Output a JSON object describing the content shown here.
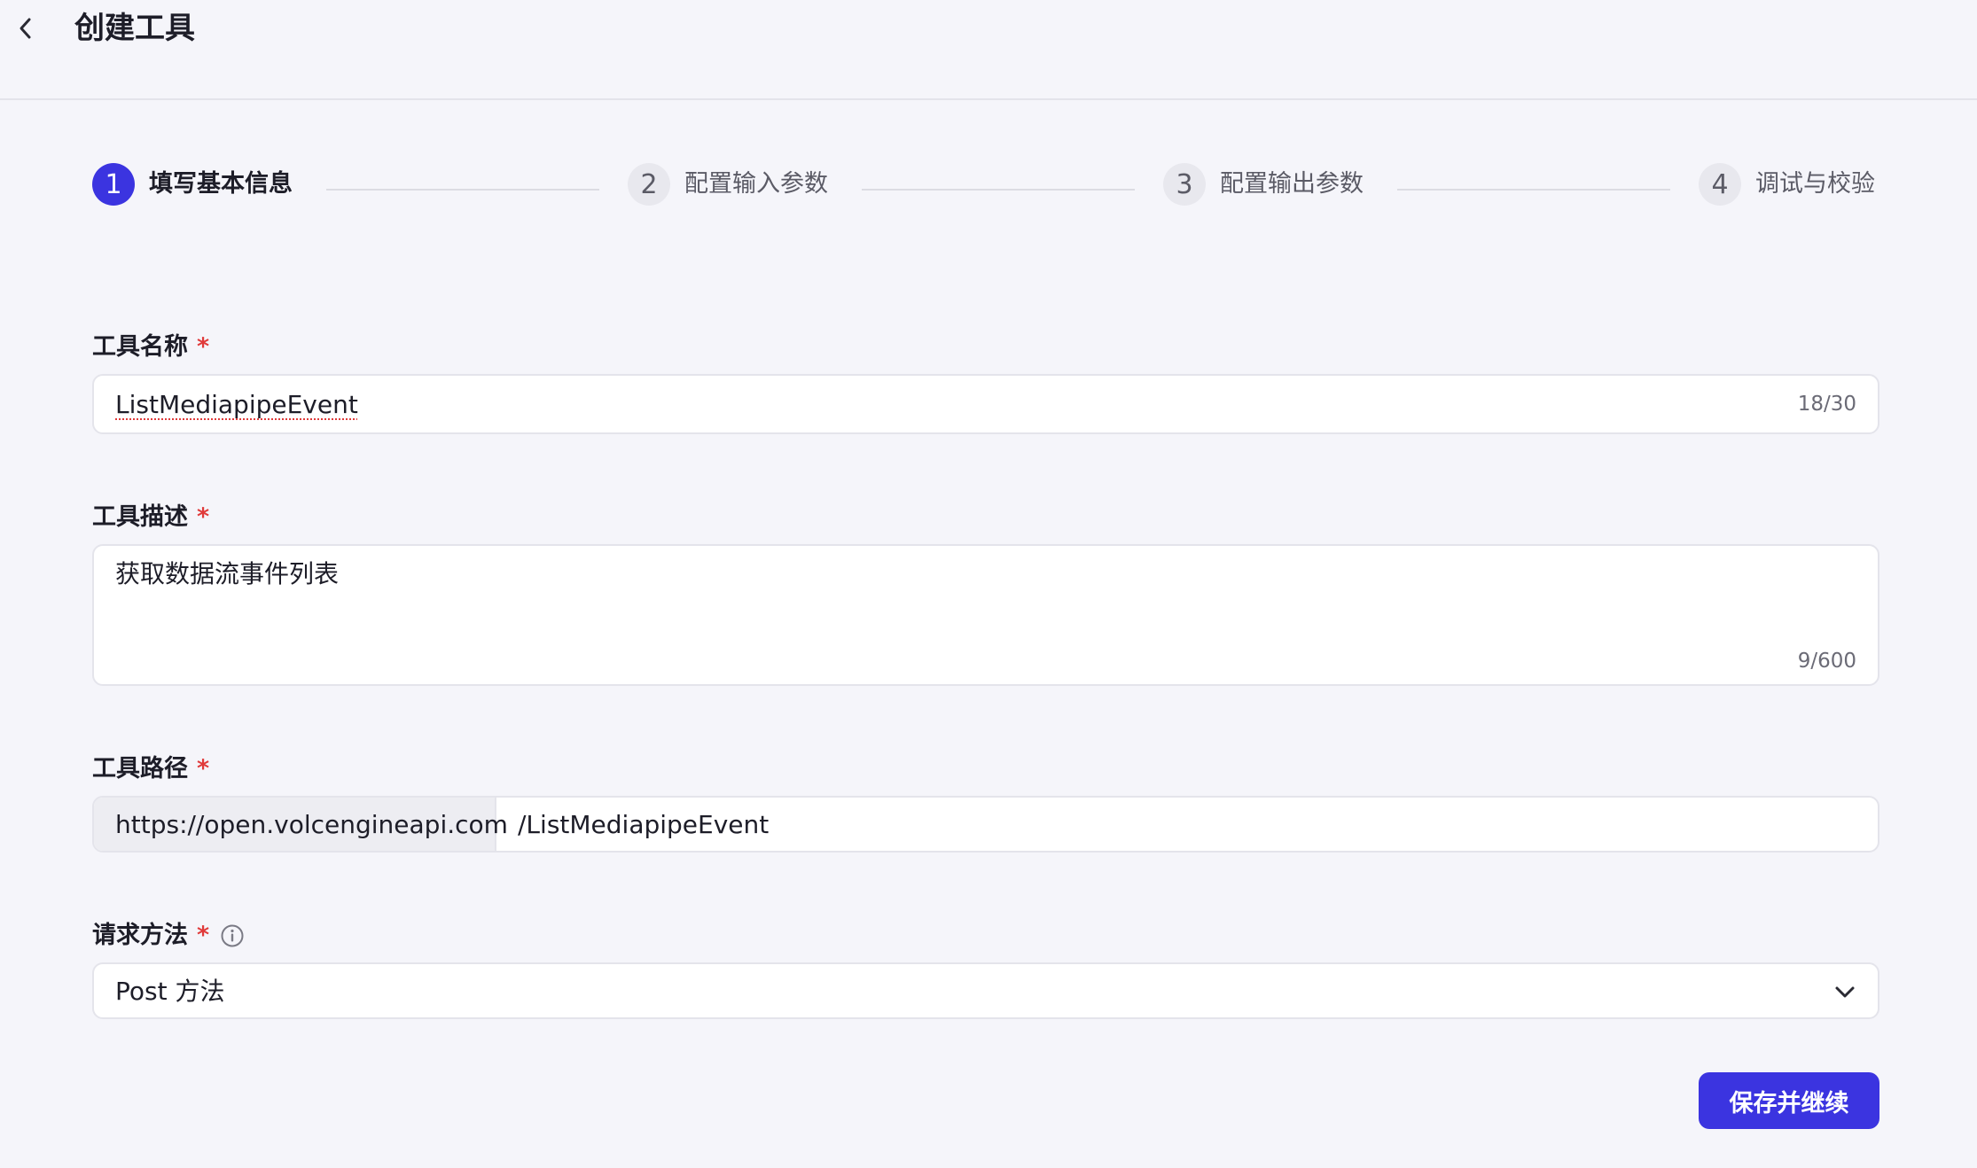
{
  "header": {
    "title": "创建工具"
  },
  "steps": [
    {
      "number": "1",
      "label": "填写基本信息",
      "active": true
    },
    {
      "number": "2",
      "label": "配置输入参数",
      "active": false
    },
    {
      "number": "3",
      "label": "配置输出参数",
      "active": false
    },
    {
      "number": "4",
      "label": "调试与校验",
      "active": false
    }
  ],
  "form": {
    "name": {
      "label": "工具名称",
      "required": "*",
      "value": "ListMediapipeEvent",
      "counter": "18/30"
    },
    "description": {
      "label": "工具描述",
      "required": "*",
      "value": "获取数据流事件列表",
      "counter": "9/600"
    },
    "path": {
      "label": "工具路径",
      "required": "*",
      "prefix": "https://open.volcengineapi.com",
      "value": "/ListMediapipeEvent"
    },
    "method": {
      "label": "请求方法",
      "required": "*",
      "value": "Post 方法"
    }
  },
  "actions": {
    "save_label": "保存并继续"
  },
  "colors": {
    "accent": "#3b34e0",
    "required": "#e03a3a",
    "background": "#f5f5fa"
  },
  "icons": {
    "back": "chevron-left-icon",
    "info": "info-icon",
    "dropdown": "chevron-down-icon"
  }
}
